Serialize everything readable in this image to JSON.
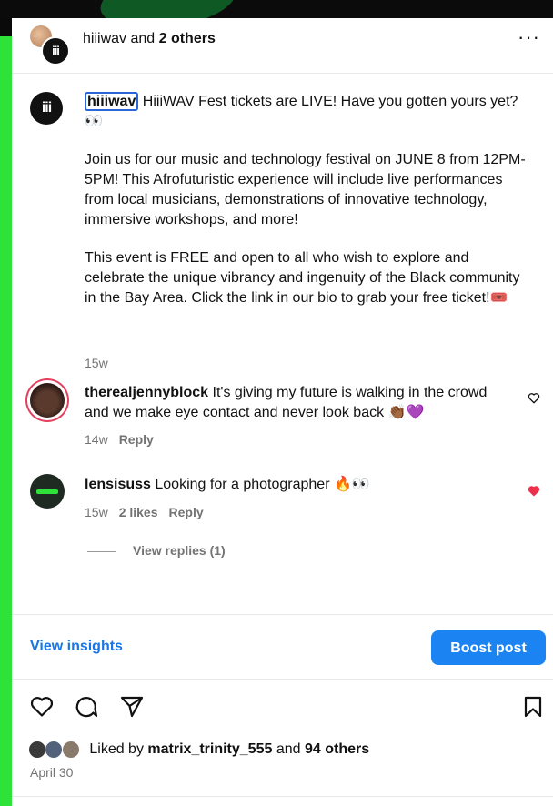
{
  "header": {
    "username": "hiiiwav",
    "joiner": " and ",
    "others": "2 others",
    "logo_text": "iii",
    "more": "···"
  },
  "caption": {
    "logo_text": "iii",
    "mention": "hiiiwav",
    "line1": " HiiiWAV Fest tickets are LIVE! Have you gotten yours yet?👀",
    "para2": "Join us for our music and technology festival on JUNE 8 from 12PM-5PM! This Afrofuturistic experience will include live performances from local musicians, demonstrations of innovative technology, immersive workshops, and more!",
    "para3": "This event is FREE and open to all who wish to explore and celebrate the unique vibrancy and ingenuity of the Black community in the Bay Area. Click the link in our bio to grab your free ticket!🎟️",
    "time": "15w"
  },
  "comments": [
    {
      "username": "therealjennyblock",
      "text": " It's giving my future is walking in the crowd and we make eye contact and never look back 👏🏾💜",
      "time": "14w",
      "likes": "",
      "reply": "Reply",
      "liked": false
    },
    {
      "username": "lensisuss",
      "text": " Looking for a photographer 🔥👀",
      "time": "15w",
      "likes": "2 likes",
      "reply": "Reply",
      "liked": true
    }
  ],
  "view_replies": "View replies (1)",
  "insights_label": "View insights",
  "boost_label": "Boost post",
  "likes": {
    "prefix": "Liked by ",
    "user": "matrix_trinity_555",
    "joiner": " and ",
    "others": "94 others"
  },
  "date": "April 30",
  "colors": {
    "accent_green": "#2fe23a",
    "link_blue": "#1976e6",
    "boost_blue": "#1b84f2",
    "liked_red": "#ed2f4b"
  }
}
